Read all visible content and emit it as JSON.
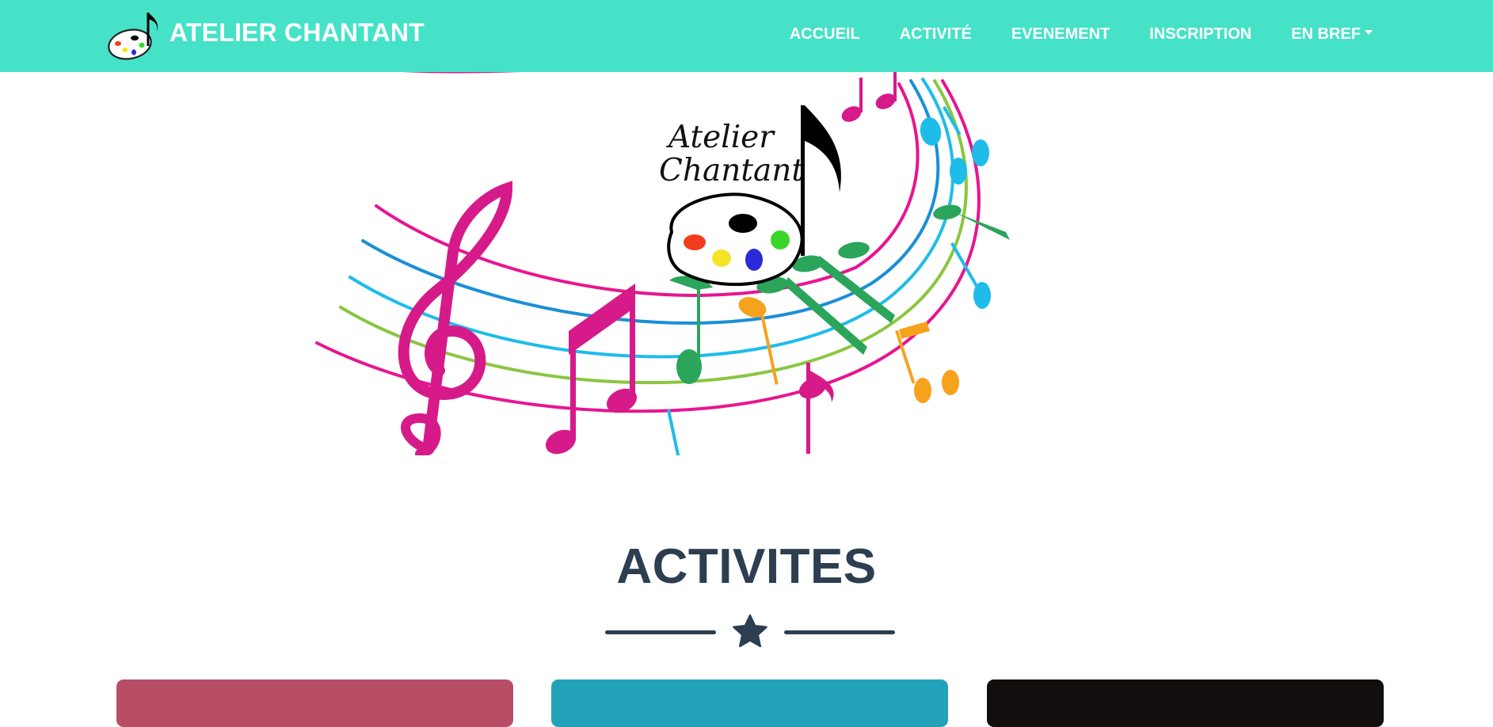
{
  "brand": {
    "name": "ATELIER CHANTANT",
    "logo_icon": "palette-music-note-icon"
  },
  "nav": {
    "items": [
      {
        "label": "ACCUEIL"
      },
      {
        "label": "ACTIVITÉ"
      },
      {
        "label": "EVENEMENT"
      },
      {
        "label": "INSCRIPTION"
      },
      {
        "label": "EN BREF"
      }
    ]
  },
  "hero": {
    "title_line1": "Atelier",
    "title_line2": "Chantant",
    "image": "music-staff-illustration"
  },
  "section": {
    "title": "ACTIVITES",
    "divider_icon": "star-icon"
  },
  "cards": [
    {
      "color": "#b84e66"
    },
    {
      "color": "#22a1b8"
    },
    {
      "color": "#130f0f"
    }
  ],
  "colors": {
    "navbar": "#45e2c8",
    "heading": "#2c3e50",
    "pink": "#e8158f",
    "blue": "#1a8fd6",
    "cyan": "#1fbcea",
    "green": "#8ac640",
    "orange": "#f7a21d"
  }
}
